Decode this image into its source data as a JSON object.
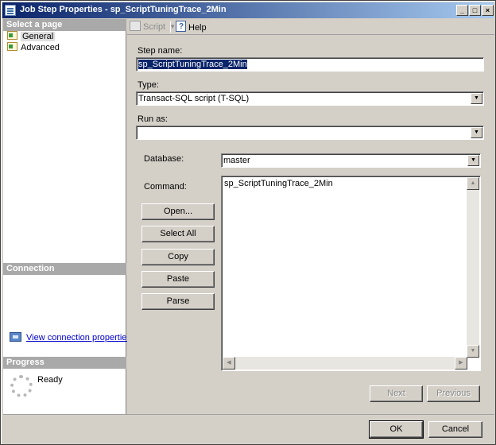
{
  "window": {
    "title": "Job Step Properties - sp_ScriptTuningTrace_2Min",
    "minimize_glyph": "_",
    "maximize_glyph": "□",
    "close_glyph": "×"
  },
  "sidebar": {
    "select_page_header": "Select a page",
    "pages": [
      {
        "label": "General",
        "icon": "page-icon"
      },
      {
        "label": "Advanced",
        "icon": "page-icon"
      }
    ],
    "connection_header": "Connection",
    "connection_link": "View connection properties",
    "progress_header": "Progress",
    "progress_status": "Ready"
  },
  "toolbar": {
    "script_label": "Script",
    "help_label": "Help"
  },
  "form": {
    "step_name_label": "Step name:",
    "step_name_value": "sp_ScriptTuningTrace_2Min",
    "type_label": "Type:",
    "type_value": "Transact-SQL script (T-SQL)",
    "run_as_label": "Run as:",
    "run_as_value": "",
    "database_label": "Database:",
    "database_value": "master",
    "command_label": "Command:",
    "command_value": "sp_ScriptTuningTrace_2Min"
  },
  "command_buttons": {
    "open": "Open...",
    "select_all": "Select All",
    "copy": "Copy",
    "paste": "Paste",
    "parse": "Parse"
  },
  "nav_buttons": {
    "next": "Next",
    "previous": "Previous"
  },
  "dialog_buttons": {
    "ok": "OK",
    "cancel": "Cancel"
  }
}
